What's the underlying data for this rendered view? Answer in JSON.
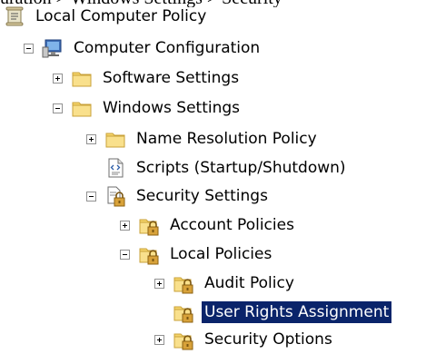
{
  "partial_top_text": "uration > Windows Settings > Security",
  "tree": {
    "root": "Local Computer Policy",
    "computer_config": "Computer Configuration",
    "software_settings": "Software Settings",
    "windows_settings": "Windows Settings",
    "name_resolution": "Name Resolution Policy",
    "scripts": "Scripts (Startup/Shutdown)",
    "security_settings": "Security Settings",
    "account_policies": "Account Policies",
    "local_policies": "Local Policies",
    "audit_policy": "Audit Policy",
    "user_rights": "User Rights Assignment",
    "security_options": "Security Options"
  },
  "icons": {
    "root": "policy-scroll-icon",
    "computer_config": "computer-icon",
    "software_settings": "folder-icon",
    "windows_settings": "folder-icon",
    "name_resolution": "folder-icon",
    "scripts": "script-document-icon",
    "security_settings": "security-settings-icon",
    "account_policies": "secure-folder-icon",
    "local_policies": "secure-folder-icon",
    "audit_policy": "secure-folder-icon",
    "user_rights": "secure-folder-icon",
    "security_options": "secure-folder-icon"
  },
  "colors": {
    "selection_bg": "#0a246a",
    "selection_text": "#ffffff",
    "folder": "#f5d46a"
  }
}
